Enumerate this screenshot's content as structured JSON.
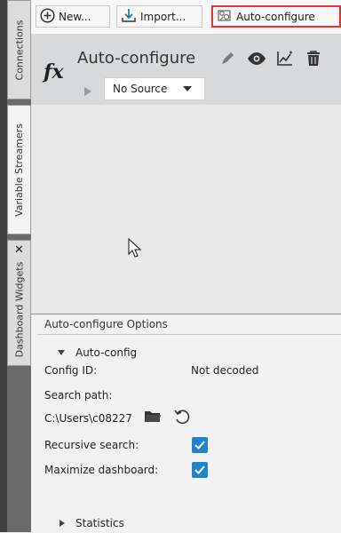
{
  "sidebar": {
    "tabs": [
      {
        "label": "Connections"
      },
      {
        "label": "Variable Streamers"
      },
      {
        "label": "Dashboard Widgets"
      }
    ]
  },
  "toolbar": {
    "new_label": "New...",
    "import_label": "Import...",
    "autoconfigure_label": "Auto-configure"
  },
  "widget": {
    "symbol": "fx",
    "title": "Auto-configure",
    "source_selected": "No Source"
  },
  "options": {
    "title": "Auto-configure Options",
    "section_label": "Auto-config",
    "config_id_label": "Config ID:",
    "config_id_value": "Not decoded",
    "search_path_label": "Search path:",
    "search_path_value": "C:\\Users\\c08227",
    "recursive_label": "Recursive search:",
    "recursive_checked": true,
    "maximize_label": "Maximize dashboard:",
    "maximize_checked": true,
    "statistics_label": "Statistics"
  },
  "colors": {
    "highlight_border": "#e0353a",
    "checkbox": "#1f84cc",
    "card_bg": "#d7d9db"
  },
  "icons": {
    "new": "plus-circle-icon",
    "import": "download-icon",
    "autoconfigure": "auto-configure-icon",
    "edit": "pencil-icon",
    "view": "eye-icon",
    "chart": "chart-icon",
    "delete": "trash-icon",
    "folder": "folder-icon",
    "reset": "reset-icon"
  }
}
